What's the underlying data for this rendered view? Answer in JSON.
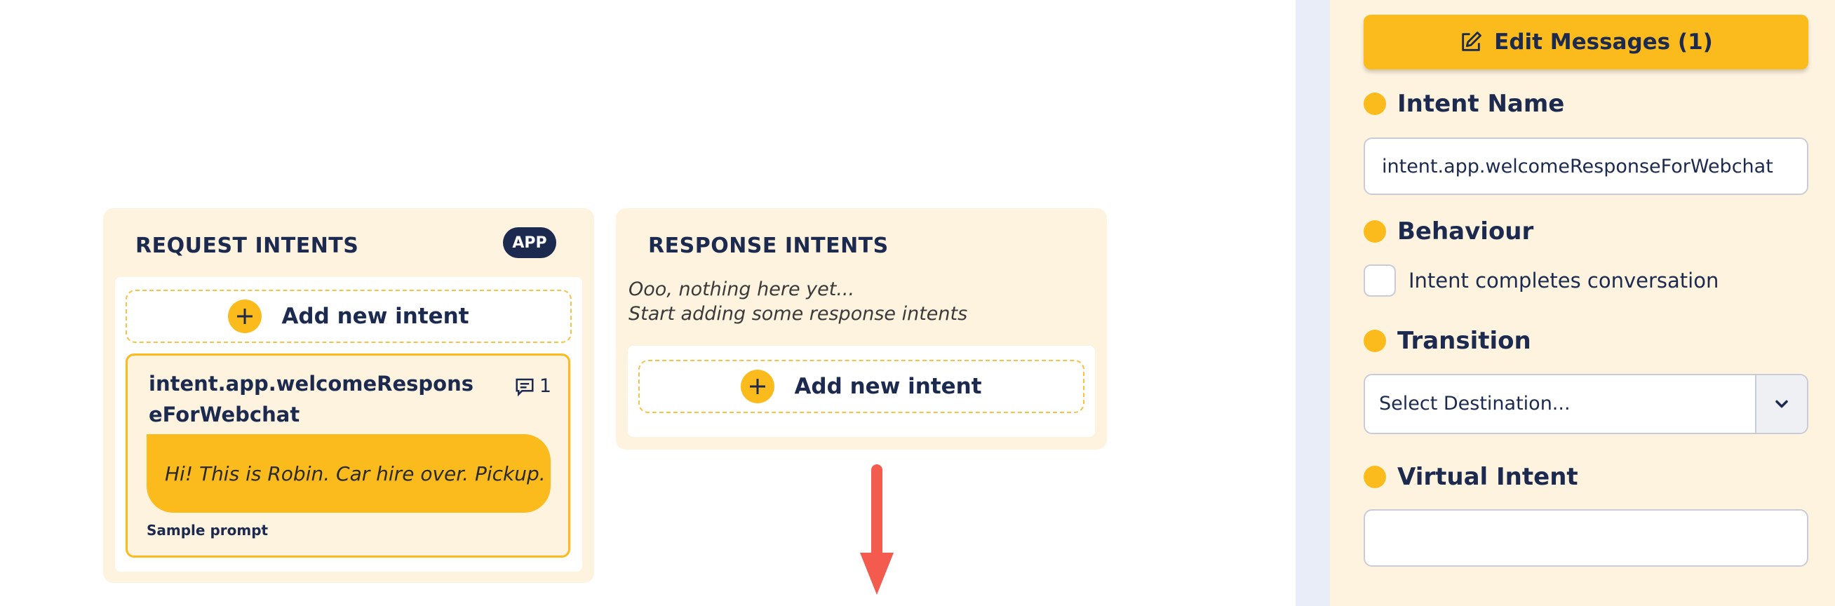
{
  "request_column": {
    "title": "REQUEST INTENTS",
    "badge": "APP",
    "add_label": "Add new intent",
    "card": {
      "name": "intent.app.welcomeResponseForWebchat",
      "message_count": "1",
      "sample_text": "Hi! This is Robin. Car hire over. Pickup.",
      "sample_caption": "Sample prompt"
    }
  },
  "response_column": {
    "title": "RESPONSE INTENTS",
    "empty_line1": "Ooo, nothing here yet...",
    "empty_line2": "Start adding some response intents",
    "add_label": "Add new intent"
  },
  "panel": {
    "edit_button": "Edit Messages (1)",
    "intent_name_label": "Intent Name",
    "intent_name_value": "intent.app.welcomeResponseForWebchat",
    "behaviour_label": "Behaviour",
    "behaviour_checkbox_label": "Intent completes conversation",
    "transition_label": "Transition",
    "transition_value": "Select Destination...",
    "virtual_intent_label": "Virtual Intent",
    "virtual_intent_value": ""
  },
  "colors": {
    "accent": "#fbbb1c",
    "navy": "#1b2a4e",
    "cream": "#fdf3df",
    "arrow": "#f25b4e"
  }
}
